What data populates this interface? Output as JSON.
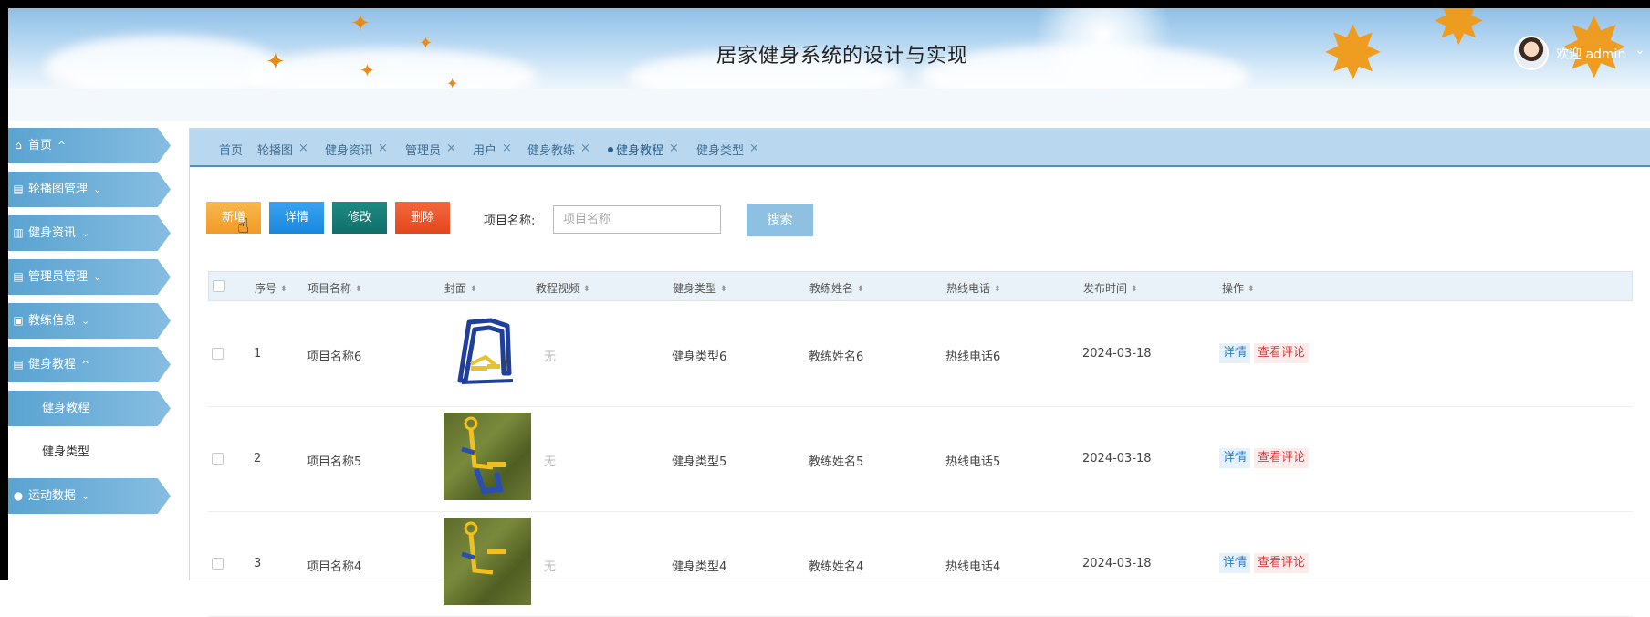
{
  "header": {
    "title": "居家健身系统的设计与实现",
    "welcome": "欢迎 admin"
  },
  "sidebar": {
    "items": [
      {
        "label": "首页",
        "icon": "home-icon"
      },
      {
        "label": "轮播图管理",
        "icon": "list-icon"
      },
      {
        "label": "健身资讯",
        "icon": "list-icon"
      },
      {
        "label": "管理员管理",
        "icon": "list-icon"
      },
      {
        "label": "教练信息",
        "icon": "folder-icon"
      },
      {
        "label": "健身教程",
        "icon": "list-icon"
      },
      {
        "label": "运动数据",
        "icon": "check-circle-icon"
      }
    ],
    "sub_items": [
      "健身教程",
      "健身类型"
    ]
  },
  "tabs": [
    "首页",
    "轮播图",
    "健身资讯",
    "管理员",
    "用户",
    "健身教练",
    "健身教程",
    "健身类型"
  ],
  "toolbar": {
    "add": "新增",
    "detail": "详情",
    "edit": "修改",
    "delete": "删除",
    "search_label": "项目名称:",
    "search_placeholder": "项目名称",
    "search_button": "搜索"
  },
  "table": {
    "columns": [
      "序号",
      "项目名称",
      "封面",
      "教程视频",
      "健身类型",
      "教练姓名",
      "热线电话",
      "发布时间",
      "操作"
    ],
    "rows": [
      {
        "no": "1",
        "name": "项目名称6",
        "video": "无",
        "type": "健身类型6",
        "coach": "教练姓名6",
        "phone": "热线电话6",
        "date": "2024-03-18"
      },
      {
        "no": "2",
        "name": "项目名称5",
        "video": "无",
        "type": "健身类型5",
        "coach": "教练姓名5",
        "phone": "热线电话5",
        "date": "2024-03-18"
      },
      {
        "no": "3",
        "name": "项目名称4",
        "video": "无",
        "type": "健身类型4",
        "coach": "教练姓名4",
        "phone": "热线电话4",
        "date": "2024-03-18"
      }
    ],
    "op_detail": "详情",
    "op_comment": "查看评论"
  },
  "colors": {
    "accent": "#5aa3d2",
    "add": "#f29a26",
    "detail": "#1788e0",
    "edit": "#0f6f69",
    "delete": "#e4461c"
  }
}
